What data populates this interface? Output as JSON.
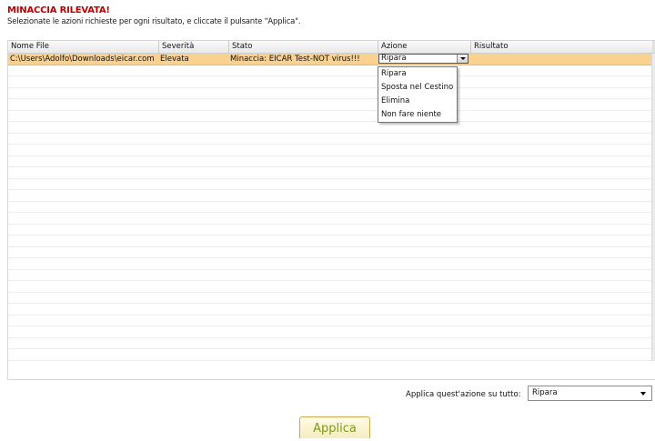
{
  "header": {
    "title": "MINACCIA RILEVATA!",
    "subtitle": "Selezionate le azioni richieste per ogni risultato, e cliccate il pulsante \"Applica\"."
  },
  "table": {
    "columns": [
      "Nome File",
      "Severità",
      "Stato",
      "Azione",
      "Risultato"
    ],
    "rows": [
      {
        "file": "C:\\Users\\Adolfo\\Downloads\\eicar.com",
        "severity": "Elevata",
        "status": "Minaccia: EICAR Test-NOT virus!!!",
        "action": "Ripara",
        "result": ""
      }
    ]
  },
  "action_dropdown": {
    "options": [
      "Ripara",
      "Sposta nel Cestino",
      "Elimina",
      "Non fare niente"
    ]
  },
  "apply_all": {
    "label": "Applica quest'azione su tutto:",
    "selected": "Ripara"
  },
  "apply_button": {
    "label": "Applica"
  },
  "colors": {
    "title": "#c00000",
    "selected_row": "#fbd18f",
    "apply_text": "#7a9a1a"
  }
}
